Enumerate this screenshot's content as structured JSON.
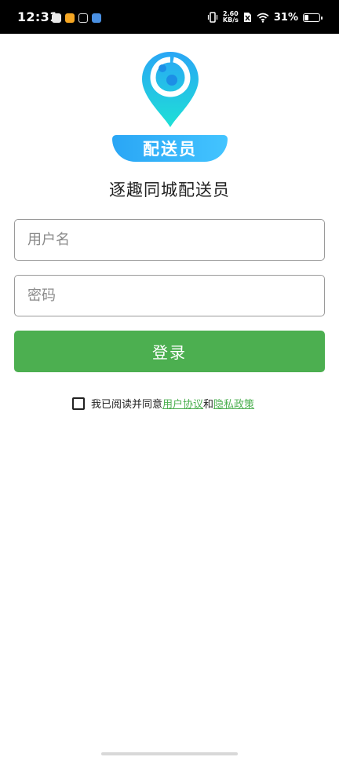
{
  "status_bar": {
    "time": "12:31",
    "net_speed_value": "2.60",
    "net_speed_unit": "KB/s",
    "battery_percent": "31%",
    "battery_level": 0.31,
    "app_icons": [
      "message-icon",
      "weibo-icon",
      "tiktok-icon",
      "app-icon"
    ]
  },
  "logo": {
    "banner_text": "配送员",
    "colors": {
      "pin_top": "#2aa6f5",
      "pin_bottom": "#1ee0d6",
      "banner": "#2aa6f5"
    }
  },
  "app_title": "逐趣同城配送员",
  "form": {
    "username_placeholder": "用户名",
    "password_placeholder": "密码",
    "login_label": "登录"
  },
  "agreement": {
    "prefix": "我已阅读并同意",
    "user_agreement": "用户协议",
    "conjunction": "和",
    "privacy_policy": "隐私政策",
    "checked": false
  },
  "accent_color": "#4caf50"
}
